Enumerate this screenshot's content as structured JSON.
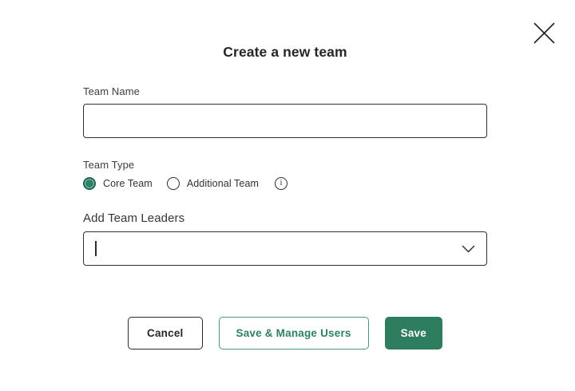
{
  "modal": {
    "title": "Create a new team"
  },
  "form": {
    "team_name": {
      "label": "Team Name",
      "value": "",
      "placeholder": ""
    },
    "team_type": {
      "label": "Team Type",
      "options": [
        {
          "label": "Core Team",
          "selected": true
        },
        {
          "label": "Additional Team",
          "selected": false
        }
      ],
      "info_icon_glyph": "i"
    },
    "team_leaders": {
      "label": "Add Team Leaders",
      "value": "",
      "placeholder": ""
    }
  },
  "actions": {
    "cancel_label": "Cancel",
    "save_manage_label": "Save & Manage Users",
    "save_label": "Save"
  },
  "colors": {
    "primary_green": "#2e7d5e",
    "radio_green": "#2e8164",
    "dark_text": "#26262a",
    "border_dark": "#2f2f2f"
  }
}
